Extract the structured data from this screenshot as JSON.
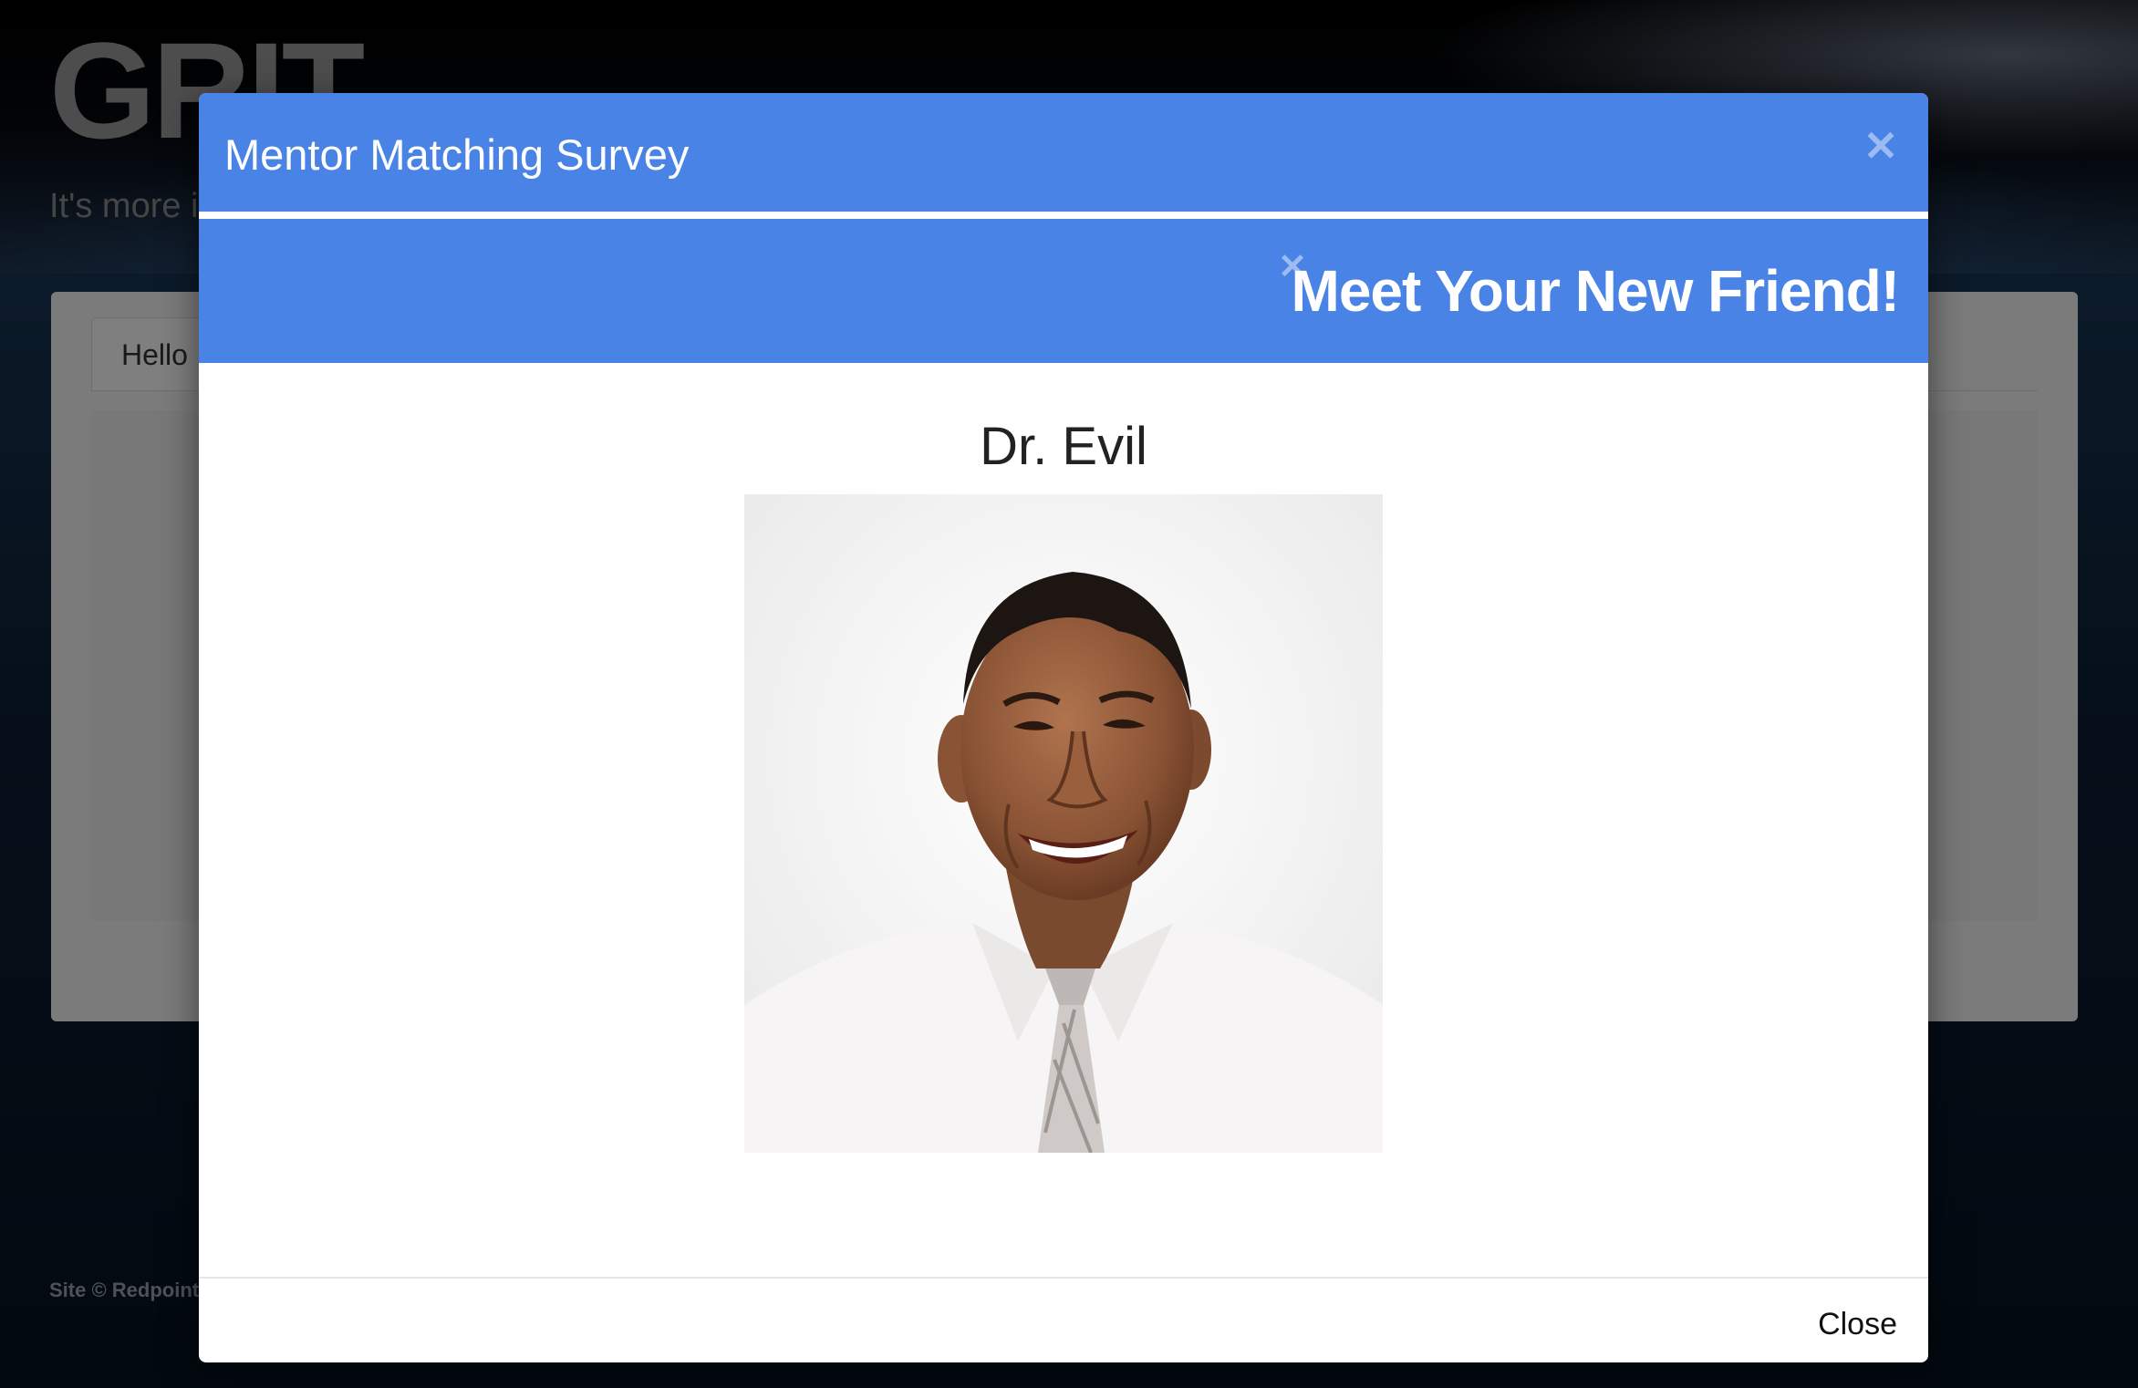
{
  "background": {
    "brand_title": "GRIT",
    "tagline": "It's more i",
    "tab_label": "Hello",
    "footer": "Site © Redpoint"
  },
  "modal": {
    "title": "Mentor Matching Survey",
    "close_icon": "close-icon",
    "inner_title": "Meet Your New Friend!",
    "friend_name": "Dr. Evil",
    "photo_alt": "",
    "close_button_label": "Close"
  },
  "colors": {
    "header_blue": "#4a83e6",
    "close_icon": "#9cbcf1"
  }
}
